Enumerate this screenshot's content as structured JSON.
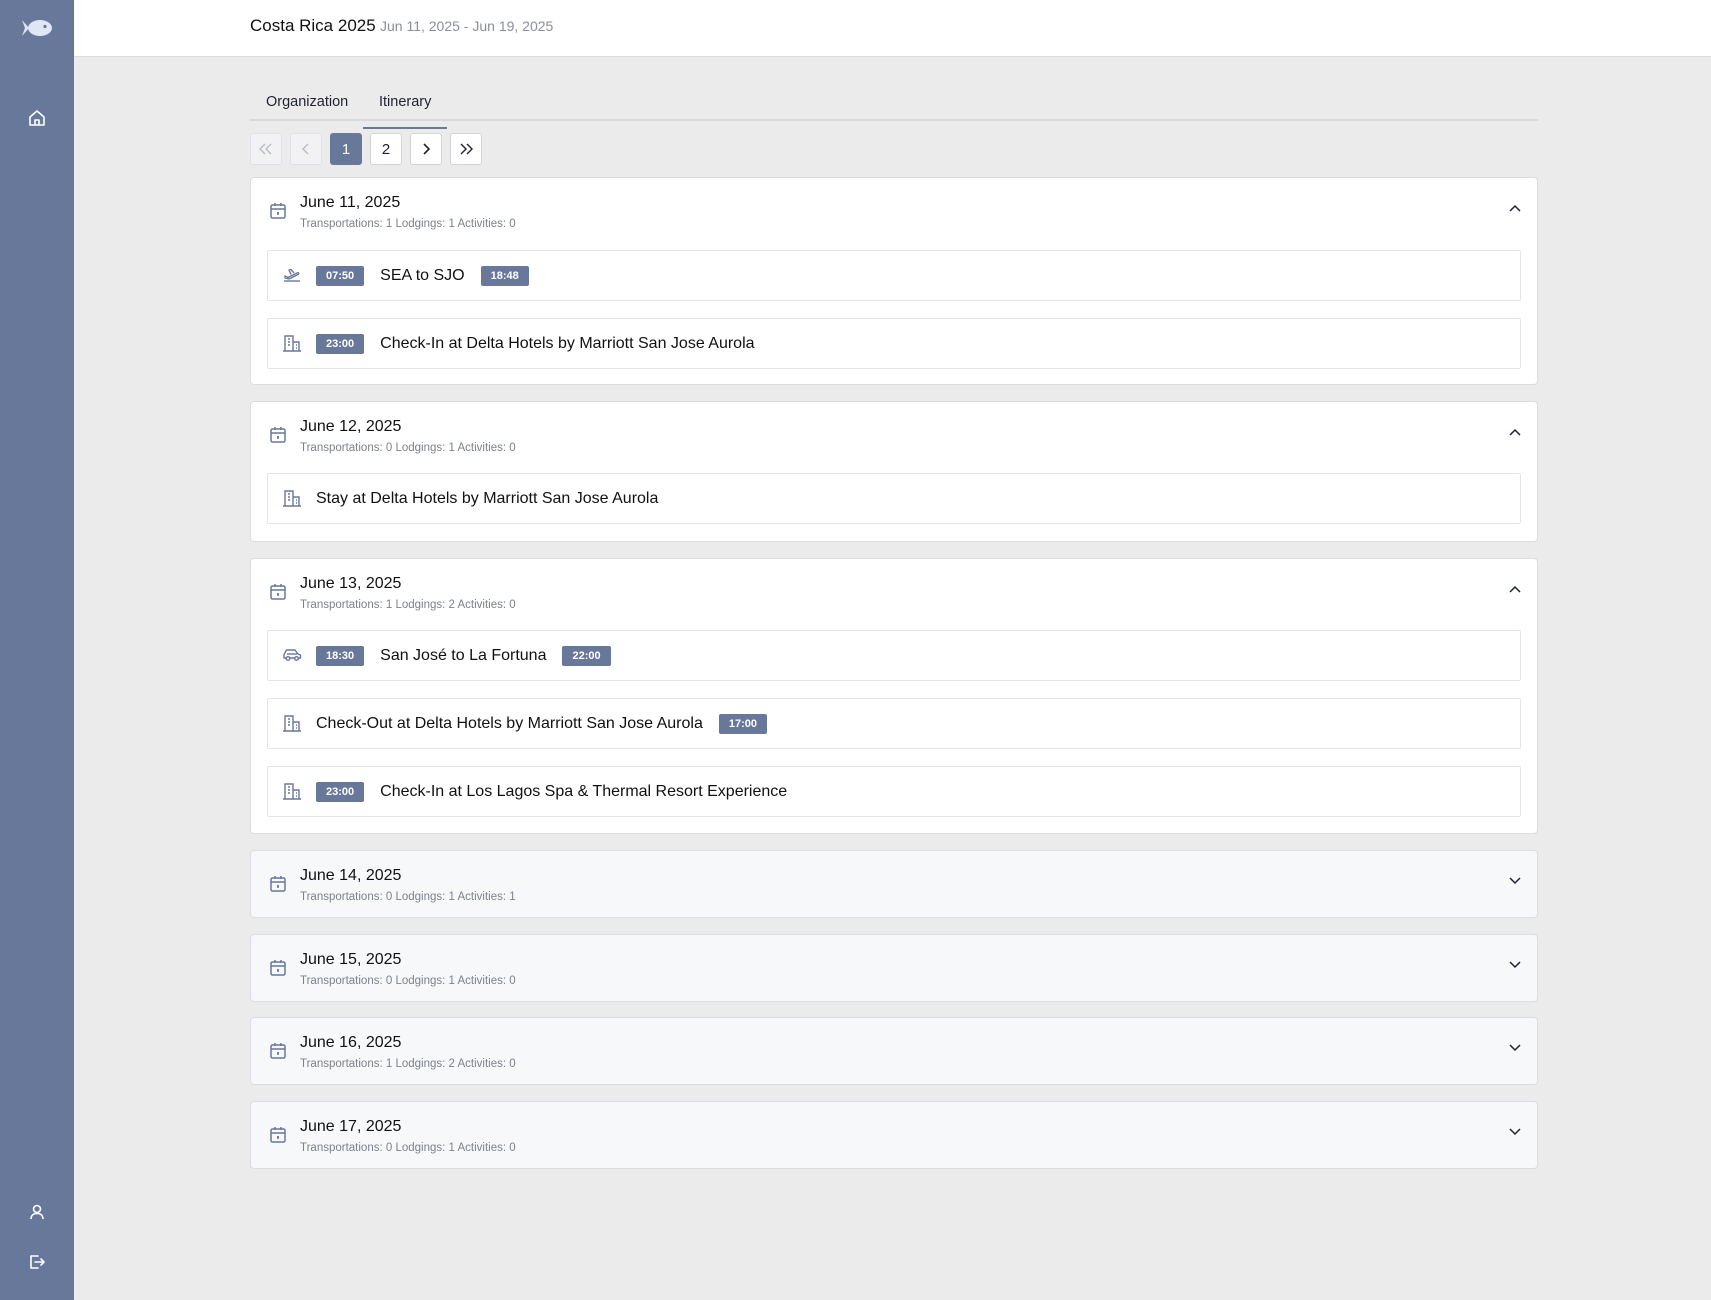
{
  "header": {
    "title": "Costa Rica 2025",
    "dates": "Jun 11, 2025 - Jun 19, 2025"
  },
  "sidebar": {
    "logo": "fish-logo",
    "items": [
      "home-icon",
      "user-icon",
      "logout-icon"
    ]
  },
  "tabs": [
    {
      "label": "Organization"
    },
    {
      "label": "Itinerary",
      "active": true
    }
  ],
  "pagination": {
    "first": "«",
    "prev": "‹",
    "pages": [
      "1",
      "2"
    ],
    "current": "1",
    "next": "›",
    "last": "»"
  },
  "days": [
    {
      "date": "June 11, 2025",
      "stats": "Transportations: 1  Lodgings: 1  Activities: 0",
      "items": [
        {
          "icon": "plane-takeoff-icon",
          "start": "07:50",
          "text": "SEA to SJO",
          "end": "18:48"
        },
        {
          "icon": "hotel-icon",
          "start": "23:00",
          "text": "Check-In at Delta Hotels by Marriott San Jose Aurola"
        }
      ]
    },
    {
      "date": "June 12, 2025",
      "stats": "Transportations: 0  Lodgings: 1  Activities: 0",
      "items": [
        {
          "icon": "hotel-icon",
          "text": "Stay at Delta Hotels by Marriott San Jose Aurola"
        }
      ]
    },
    {
      "date": "June 13, 2025",
      "stats": "Transportations: 1  Lodgings: 2  Activities: 0",
      "items": [
        {
          "icon": "car-icon",
          "start": "18:30",
          "text": "San José to La Fortuna",
          "end": "22:00"
        },
        {
          "icon": "hotel-icon",
          "text": "Check-Out at Delta Hotels by Marriott San Jose Aurola",
          "end": "17:00"
        },
        {
          "icon": "hotel-icon",
          "start": "23:00",
          "text": "Check-In at Los Lagos Spa & Thermal Resort Experience"
        }
      ]
    },
    {
      "date": "June 14, 2025",
      "stats": "Transportations: 0  Lodgings: 1  Activities: 1"
    },
    {
      "date": "June 15, 2025",
      "stats": "Transportations: 0  Lodgings: 1  Activities: 0"
    },
    {
      "date": "June 16, 2025",
      "stats": "Transportations: 1  Lodgings: 2  Activities: 0"
    },
    {
      "date": "June 17, 2025",
      "stats": "Transportations: 0  Lodgings: 1  Activities: 0"
    }
  ]
}
